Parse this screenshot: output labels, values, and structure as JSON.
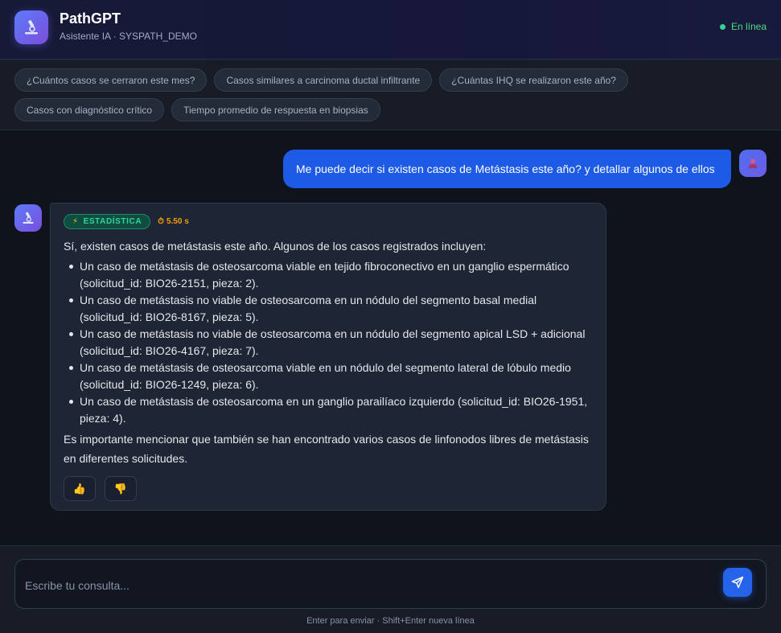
{
  "header": {
    "title": "PathGPT",
    "subtitle": "Asistente IA · SYSPATH_DEMO",
    "status": "En línea",
    "logo_icon": "microscope-icon"
  },
  "suggestions": {
    "row1": [
      "¿Cuántos casos se cerraron este mes?",
      "Casos similares a carcinoma ductal infiltrante",
      "¿Cuántas IHQ se realizaron este año?"
    ],
    "row2": [
      "Casos con diagnóstico crítico",
      "Tiempo promedio de respuesta en biopsias"
    ]
  },
  "user_message": {
    "text": "Me puede decir si existen casos de Metástasis este año?  y detallar algunos de ellos",
    "avatar_icon": "user-icon"
  },
  "bot_message": {
    "badge": "ESTADÍSTICA",
    "badge_icon": "lightning-icon",
    "time": "5.50 s",
    "time_icon": "stopwatch-icon",
    "intro": "Sí, existen casos de metástasis este año. Algunos de los casos registrados incluyen:",
    "items": [
      "Un caso de metástasis de osteosarcoma viable en tejido fibroconectivo en un ganglio espermático (solicitud_id: BIO26-2151, pieza: 2).",
      "Un caso de metástasis no viable de osteosarcoma en un nódulo del segmento basal medial (solicitud_id: BIO26-8167, pieza: 5).",
      "Un caso de metástasis no viable de osteosarcoma en un nódulo del segmento apical LSD + adicional (solicitud_id: BIO26-4167, pieza: 7).",
      "Un caso de metástasis de osteosarcoma viable en un nódulo del segmento lateral de lóbulo medio (solicitud_id: BIO26-1249, pieza: 6).",
      "Un caso de metástasis de osteosarcoma en un ganglio parailíaco izquierdo (solicitud_id: BIO26-1951, pieza: 4)."
    ],
    "outro": "Es importante mencionar que también se han encontrado varios casos de linfonodos libres de metástasis en diferentes solicitudes.",
    "thumbs_up": "👍",
    "thumbs_down": "👎"
  },
  "composer": {
    "placeholder": "Escribe tu consulta...",
    "hint": "Enter para enviar · Shift+Enter nueva línea",
    "send_icon": "send-icon"
  },
  "colors": {
    "accent": "#1d5ae6",
    "status": "#4ade80",
    "badge": "#34d399",
    "time": "#f59e0b"
  }
}
